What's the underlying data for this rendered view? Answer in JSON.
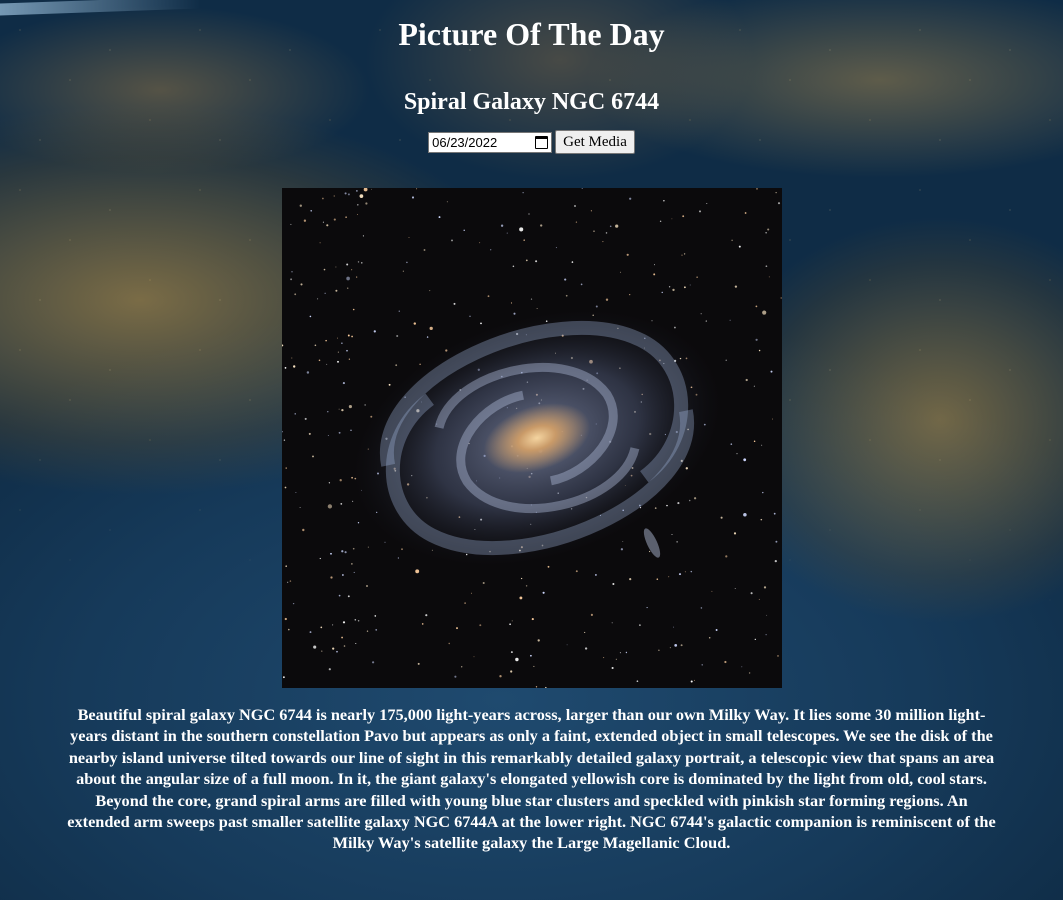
{
  "page": {
    "title": "Picture Of The Day"
  },
  "apod": {
    "title": "Spiral Galaxy NGC 6744",
    "date_value": "06/23/2022",
    "button_label": "Get Media",
    "explanation": "Beautiful spiral galaxy NGC 6744 is nearly 175,000 light-years across, larger than our own Milky Way. It lies some 30 million light-years distant in the southern constellation Pavo but appears as only a faint, extended object in small telescopes. We see the disk of the nearby island universe tilted towards our line of sight in this remarkably detailed galaxy portrait, a telescopic view that spans an area about the angular size of a full moon. In it, the giant galaxy's elongated yellowish core is dominated by the light from old, cool stars. Beyond the core, grand spiral arms are filled with young blue star clusters and speckled with pinkish star forming regions. An extended arm sweeps past smaller satellite galaxy NGC 6744A at the lower right. NGC 6744's galactic companion is reminiscent of the Milky Way's satellite galaxy the Large Magellanic Cloud."
  },
  "icons": {
    "calendar": "calendar-icon"
  },
  "colors": {
    "text": "#ffffff",
    "button_bg": "#efefef",
    "galaxy_core": "#e8c08a",
    "galaxy_arms": "#8fa6c8"
  }
}
